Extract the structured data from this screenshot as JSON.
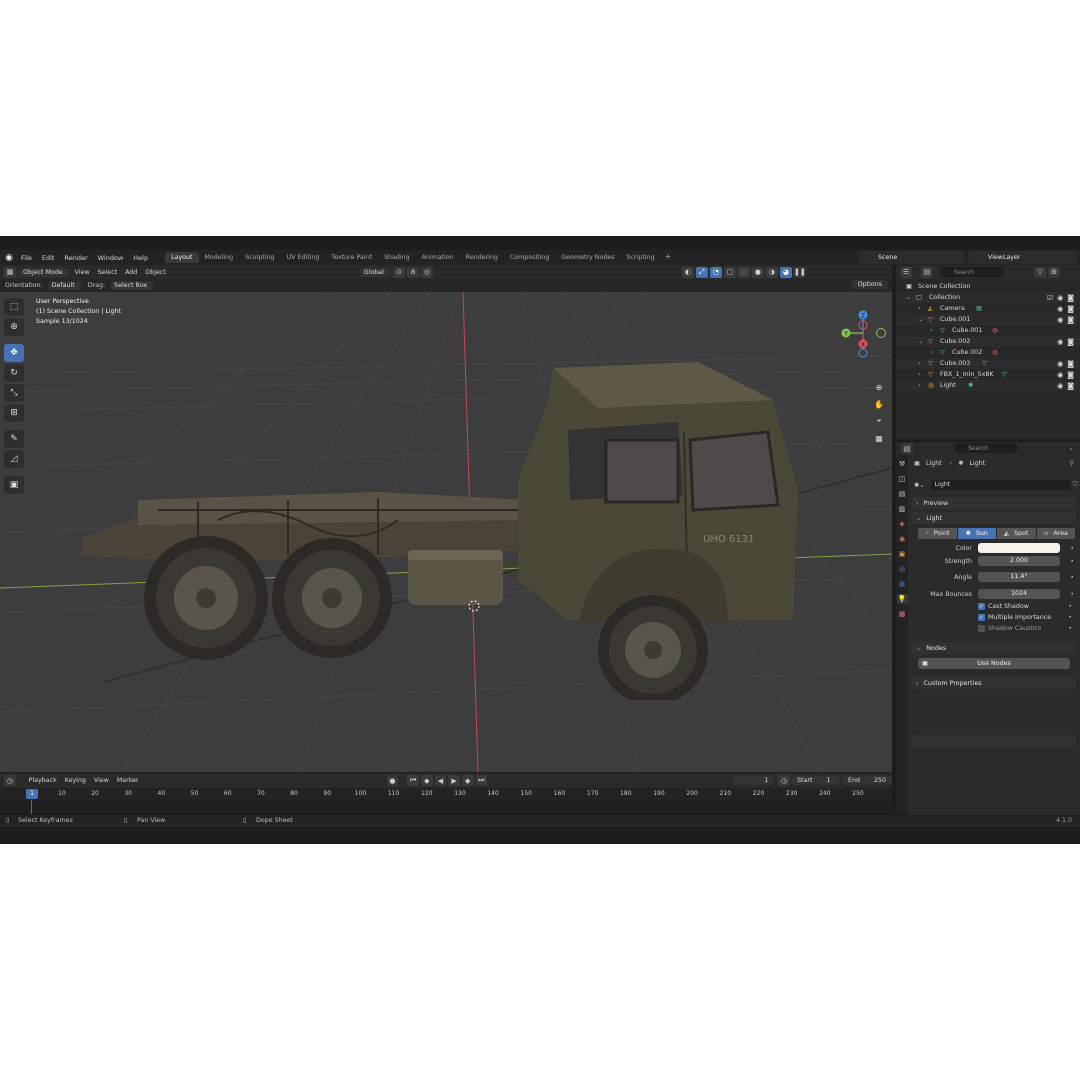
{
  "app": {
    "menu": [
      "File",
      "Edit",
      "Render",
      "Window",
      "Help"
    ],
    "workspaces": [
      "Layout",
      "Modeling",
      "Sculpting",
      "UV Editing",
      "Texture Paint",
      "Shading",
      "Animation",
      "Rendering",
      "Compositing",
      "Geometry Nodes",
      "Scripting"
    ],
    "active_workspace": "Layout",
    "scene": "Scene",
    "view_layer": "ViewLayer",
    "version": "4.1.0"
  },
  "viewport_header": {
    "mode": "Object Mode",
    "menus": [
      "View",
      "Select",
      "Add",
      "Object"
    ],
    "transform_orientation": "Global"
  },
  "tool_header": {
    "orientation_label": "Orientation:",
    "orientation_value": "Default",
    "drag_label": "Drag:",
    "drag_value": "Select Box",
    "options": "Options"
  },
  "viewport_info": {
    "line1": "User Perspective",
    "line2": "(1) Scene Collection | Light",
    "line3": "Sample 13/1024",
    "truck_marking": "UHO 6131"
  },
  "gizmo": {
    "x": "X",
    "y": "Y",
    "z": "Z"
  },
  "outliner": {
    "search_placeholder": "Search",
    "root": "Scene Collection",
    "collection": "Collection",
    "items": [
      {
        "name": "Camera",
        "indent": 1
      },
      {
        "name": "Cube.001",
        "indent": 1
      },
      {
        "name": "Cube.001",
        "indent": 2
      },
      {
        "name": "Cube.002",
        "indent": 1
      },
      {
        "name": "Cube.002",
        "indent": 2
      },
      {
        "name": "Cube.003",
        "indent": 1
      },
      {
        "name": "FBX_1_mln_5x8K",
        "indent": 1
      },
      {
        "name": "Light",
        "indent": 1
      }
    ]
  },
  "properties": {
    "search_placeholder": "Search",
    "breadcrumb_object": "Light",
    "breadcrumb_data": "Light",
    "datablock": "Light",
    "preview_panel": "Preview",
    "light_panel": "Light",
    "light_types": [
      "Point",
      "Sun",
      "Spot",
      "Area"
    ],
    "active_light_type": "Sun",
    "color_label": "Color",
    "color_value": "#f7f2ea",
    "strength_label": "Strength",
    "strength_value": "2.000",
    "angle_label": "Angle",
    "angle_value": "11.4°",
    "max_bounces_label": "Max Bounces",
    "max_bounces_value": "1024",
    "cast_shadow": "Cast Shadow",
    "multiple_importance": "Multiple Importance",
    "shadow_caustics": "Shadow Caustics",
    "nodes_panel": "Nodes",
    "use_nodes": "Use Nodes",
    "custom_properties": "Custom Properties"
  },
  "timeline": {
    "menus": [
      "Playback",
      "Keying",
      "View",
      "Marker"
    ],
    "current_frame": "1",
    "start_label": "Start",
    "start_value": "1",
    "end_label": "End",
    "end_value": "250",
    "ticks": [
      "10",
      "20",
      "30",
      "40",
      "50",
      "60",
      "70",
      "80",
      "90",
      "100",
      "110",
      "120",
      "130",
      "140",
      "150",
      "160",
      "170",
      "180",
      "190",
      "200",
      "210",
      "220",
      "230",
      "240",
      "250"
    ]
  },
  "status": {
    "select": "Select Keyframes",
    "pan": "Pan View",
    "dope": "Dope Sheet"
  },
  "colors": {
    "accent": "#4772b3",
    "viewport_bg": "#3d3d3d",
    "x_axis": "#e0525a",
    "y_axis": "#8cc34a",
    "z_axis": "#4a8ee0"
  }
}
